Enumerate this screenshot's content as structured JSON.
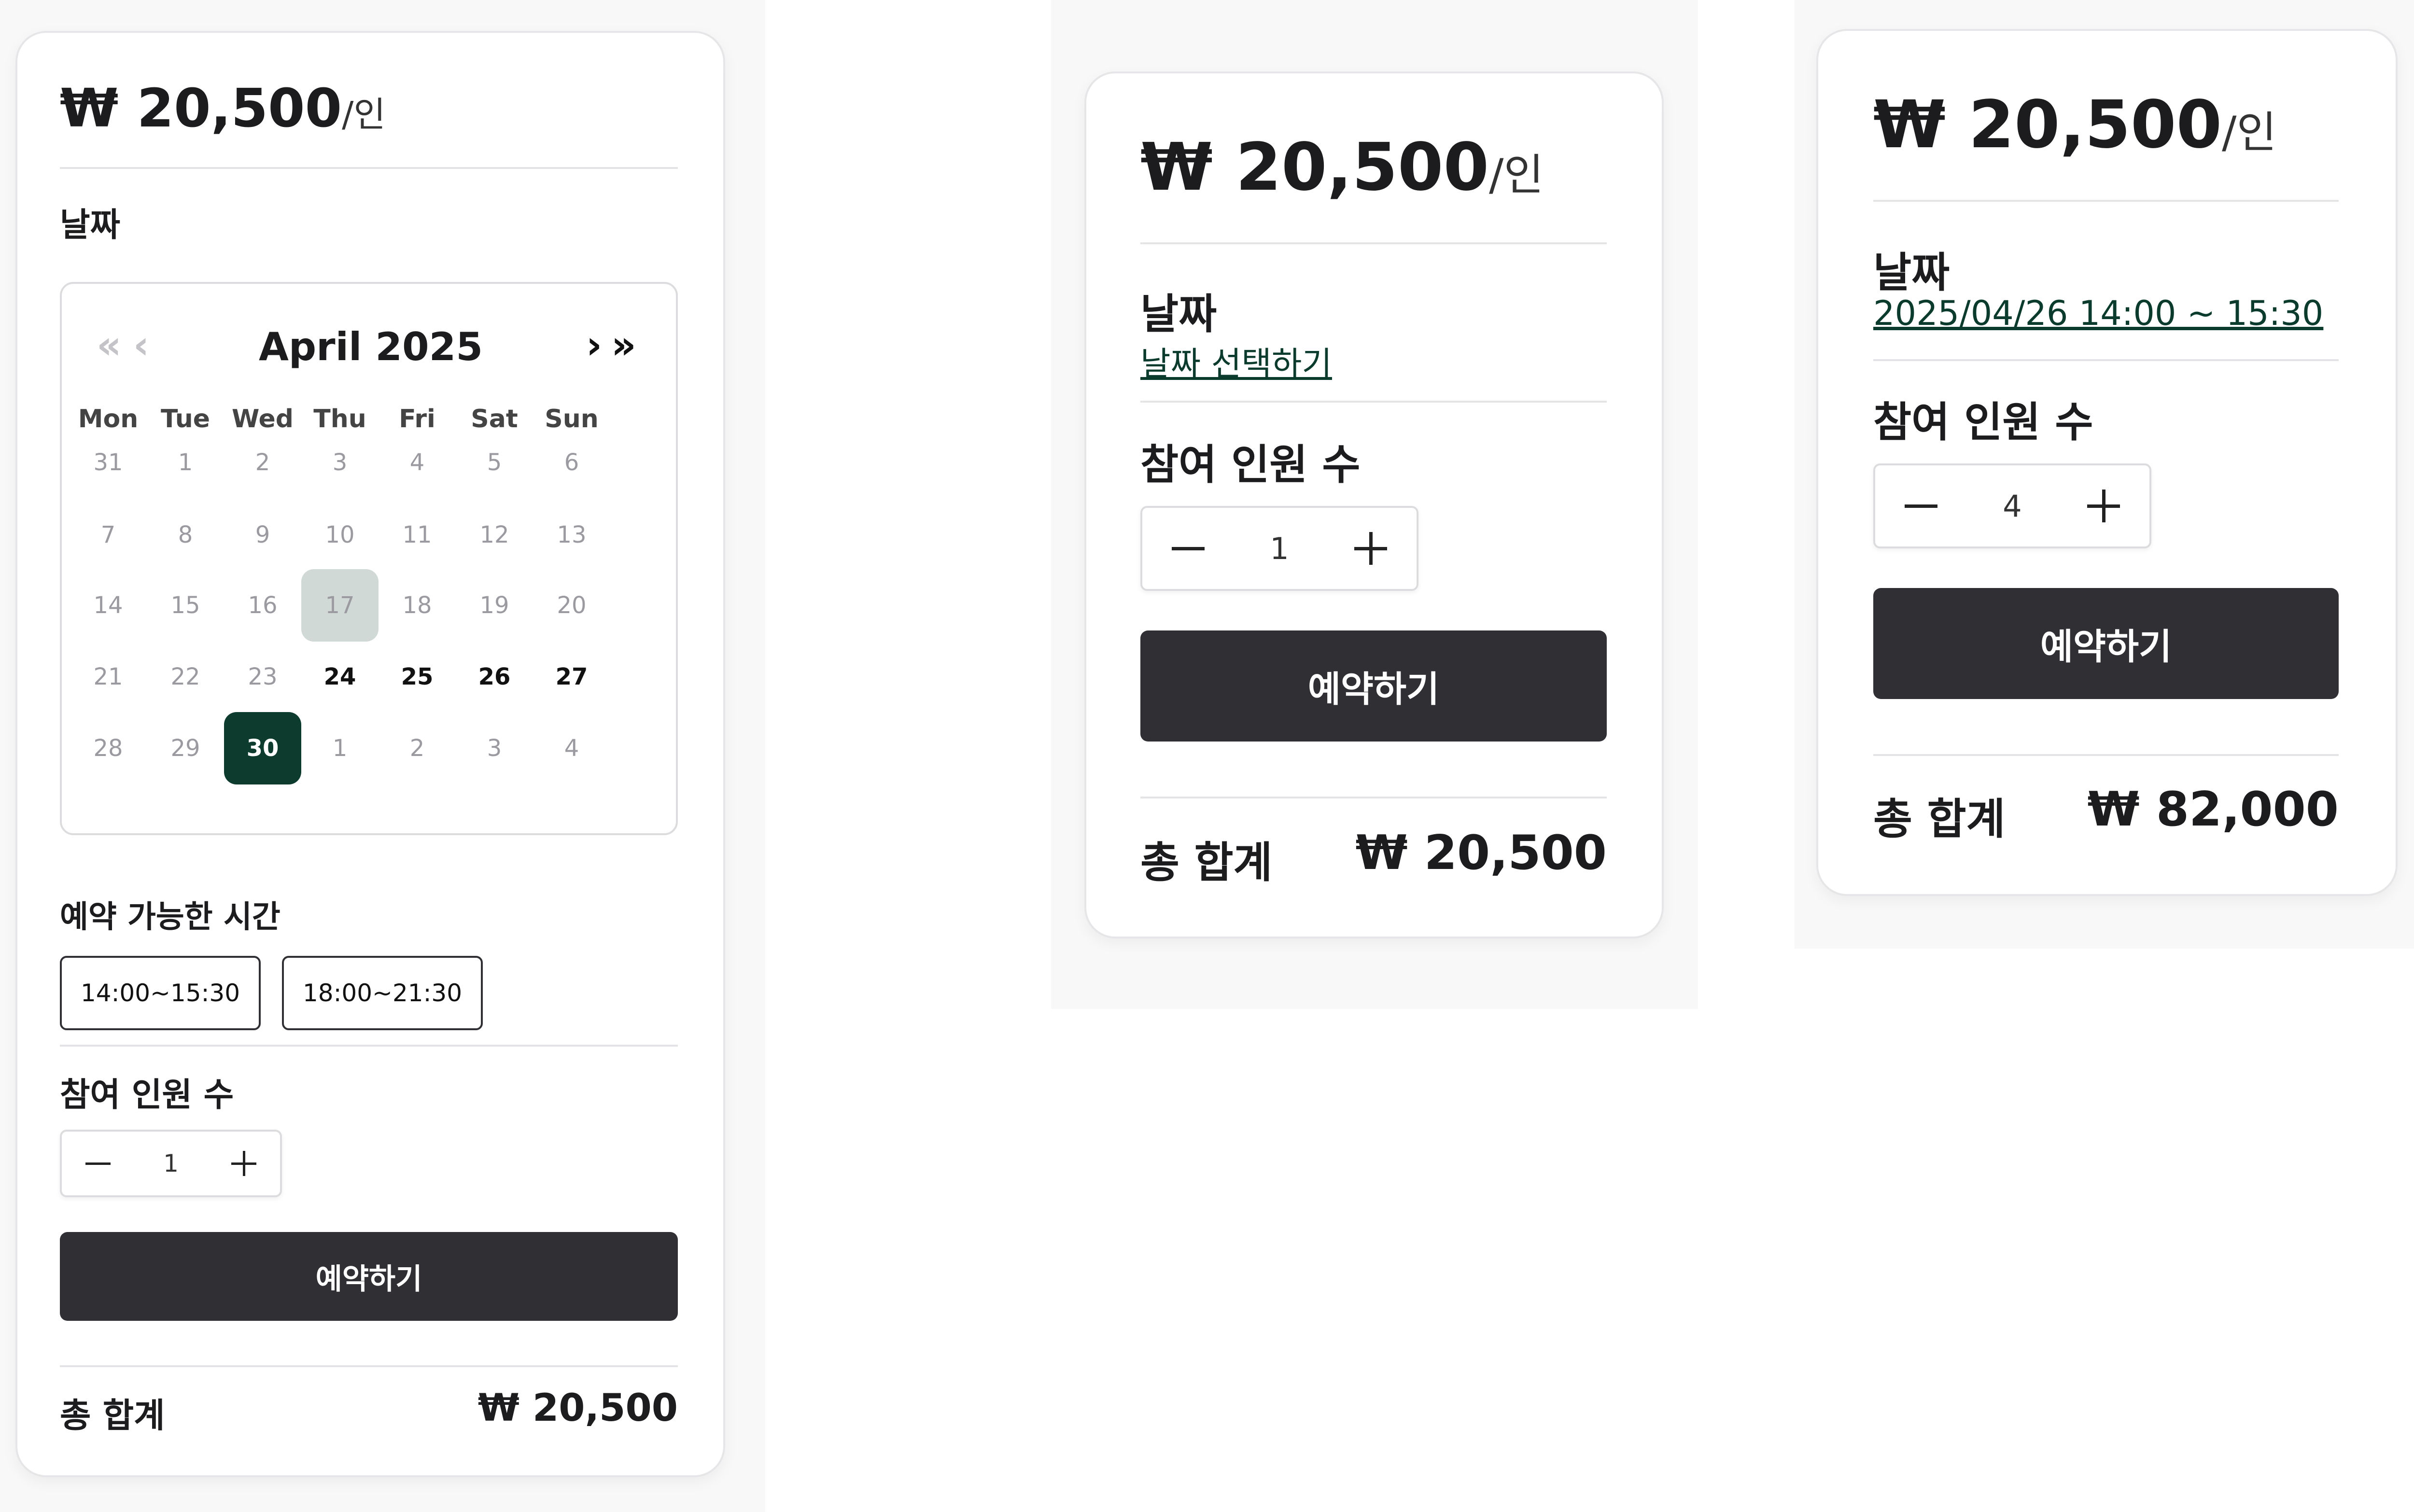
{
  "price": {
    "amount": "₩ 20,500",
    "unit": "/인"
  },
  "panel1": {
    "date_label": "날짜",
    "calendar": {
      "month_title": "April 2025",
      "prev_year": "«",
      "prev_month": "‹",
      "next_month": "›",
      "next_year": "»",
      "weekdays": [
        "Mon",
        "Tue",
        "Wed",
        "Thu",
        "Fri",
        "Sat",
        "Sun"
      ],
      "weeks": [
        [
          "31",
          "1",
          "2",
          "3",
          "4",
          "5",
          "6"
        ],
        [
          "7",
          "8",
          "9",
          "10",
          "11",
          "12",
          "13"
        ],
        [
          "14",
          "15",
          "16",
          "17",
          "18",
          "19",
          "20"
        ],
        [
          "21",
          "22",
          "23",
          "24",
          "25",
          "26",
          "27"
        ],
        [
          "28",
          "29",
          "30",
          "1",
          "2",
          "3",
          "4"
        ]
      ]
    },
    "time_label": "예약 가능한 시간",
    "slots": [
      "14:00~15:30",
      "18:00~21:30"
    ],
    "people_label": "참여 인원 수",
    "count": "1",
    "book_label": "예약하기",
    "total_label": "총 합계",
    "total_value": "₩ 20,500"
  },
  "panel2": {
    "date_label": "날짜",
    "date_link": "날짜 선택하기",
    "people_label": "참여 인원 수",
    "count": "1",
    "book_label": "예약하기",
    "total_label": "총 합계",
    "total_value": "₩ 20,500"
  },
  "panel3": {
    "date_label": "날짜",
    "date_value": "2025/04/26 14:00 ~ 15:30",
    "people_label": "참여 인원 수",
    "count": "4",
    "book_label": "예약하기",
    "total_label": "총 합계",
    "total_value": "₩ 82,000"
  },
  "icons": {
    "minus": "minus-icon",
    "plus": "plus-icon"
  },
  "colors": {
    "primary_button": "#2f2f34",
    "selected_day": "#0d3b2e",
    "today": "#d0d9d5",
    "link": "#0b3b2c"
  }
}
